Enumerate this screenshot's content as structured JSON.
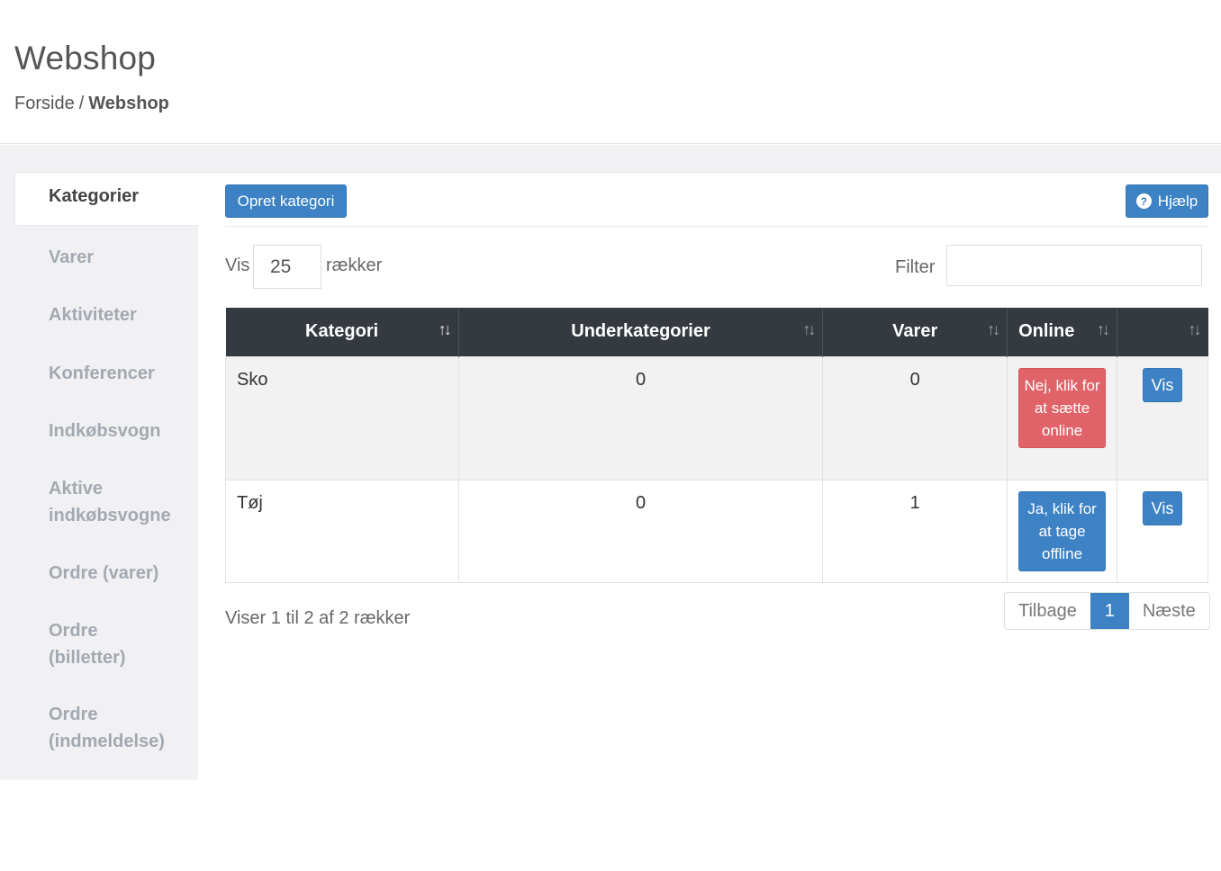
{
  "header": {
    "title": "Webshop",
    "breadcrumb": {
      "home": "Forside",
      "separator": "/",
      "current": "Webshop"
    }
  },
  "sidebar": {
    "active": "Kategorier",
    "items": [
      "Varer",
      "Aktiviteter",
      "Konferencer",
      "Indkøbsvogn",
      "Aktive",
      "indkøbsvogne",
      "Ordre (varer)",
      "Ordre",
      "(billetter)",
      "Ordre",
      "(indmeldelse)"
    ]
  },
  "toolbar": {
    "create_label": "Opret kategori",
    "help_label": "Hjælp",
    "help_icon": "question-circle-icon"
  },
  "controls": {
    "show_label": "Vis",
    "page_size": "25",
    "rows_label": "rækker",
    "filter_label": "Filter",
    "filter_value": ""
  },
  "table": {
    "columns": [
      "Kategori",
      "Underkategorier",
      "Varer",
      "Online",
      ""
    ],
    "rows": [
      {
        "kategori": "Sko",
        "underkategorier": "0",
        "varer": "0",
        "online_label": "Nej, klik for at sætte online",
        "online_status": "offline",
        "action": "Vis"
      },
      {
        "kategori": "Tøj",
        "underkategorier": "0",
        "varer": "1",
        "online_label": "Ja, klik for at tage offline",
        "online_status": "online",
        "action": "Vis"
      }
    ]
  },
  "footer": {
    "info": "Viser 1 til 2 af 2 rækker",
    "prev": "Tilbage",
    "current_page": "1",
    "next": "Næste"
  },
  "colors": {
    "primary": "#3d82c4",
    "danger": "#e06369",
    "table_header": "#343a40"
  }
}
